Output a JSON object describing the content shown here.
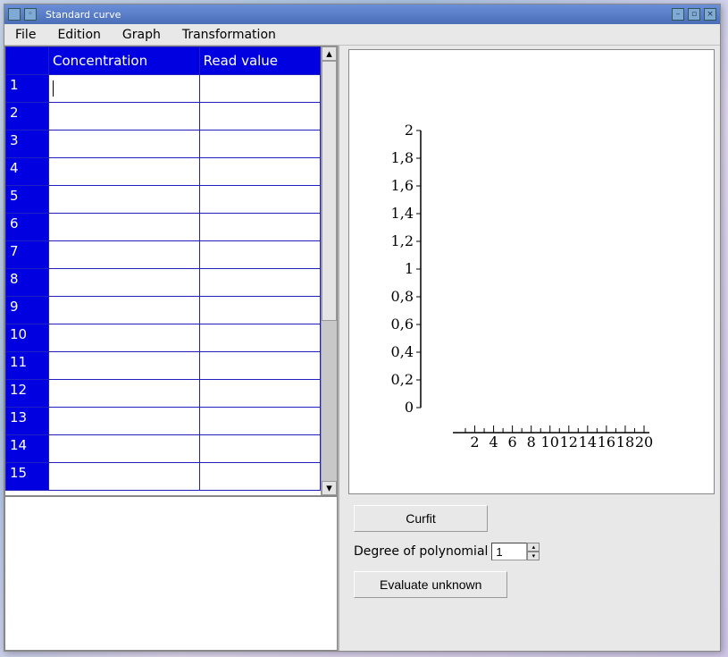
{
  "window": {
    "title": "Standard curve"
  },
  "menu": {
    "items": [
      "File",
      "Edition",
      "Graph",
      "Transformation"
    ]
  },
  "table": {
    "headers": {
      "col1": "Concentration",
      "col2": "Read value"
    },
    "row_count": 15,
    "rows": [
      {
        "n": "1",
        "c": "",
        "v": ""
      },
      {
        "n": "2",
        "c": "",
        "v": ""
      },
      {
        "n": "3",
        "c": "",
        "v": ""
      },
      {
        "n": "4",
        "c": "",
        "v": ""
      },
      {
        "n": "5",
        "c": "",
        "v": ""
      },
      {
        "n": "6",
        "c": "",
        "v": ""
      },
      {
        "n": "7",
        "c": "",
        "v": ""
      },
      {
        "n": "8",
        "c": "",
        "v": ""
      },
      {
        "n": "9",
        "c": "",
        "v": ""
      },
      {
        "n": "10",
        "c": "",
        "v": ""
      },
      {
        "n": "11",
        "c": "",
        "v": ""
      },
      {
        "n": "12",
        "c": "",
        "v": ""
      },
      {
        "n": "13",
        "c": "",
        "v": ""
      },
      {
        "n": "14",
        "c": "",
        "v": ""
      },
      {
        "n": "15",
        "c": "",
        "v": ""
      }
    ]
  },
  "controls": {
    "curfit_label": "Curfit",
    "degree_label": "Degree of polynomial",
    "degree_value": "1",
    "evaluate_label": "Evaluate unknown"
  },
  "chart_data": {
    "type": "scatter",
    "title": "",
    "xlabel": "",
    "ylabel": "",
    "x_ticks": [
      2,
      4,
      6,
      8,
      10,
      12,
      14,
      16,
      18,
      20
    ],
    "y_ticks": [
      "0",
      "0,2",
      "0,4",
      "0,6",
      "0,8",
      "1",
      "1,2",
      "1,4",
      "1,6",
      "1,8",
      "2"
    ],
    "xlim": [
      0,
      20
    ],
    "ylim": [
      0,
      2
    ],
    "series": []
  }
}
